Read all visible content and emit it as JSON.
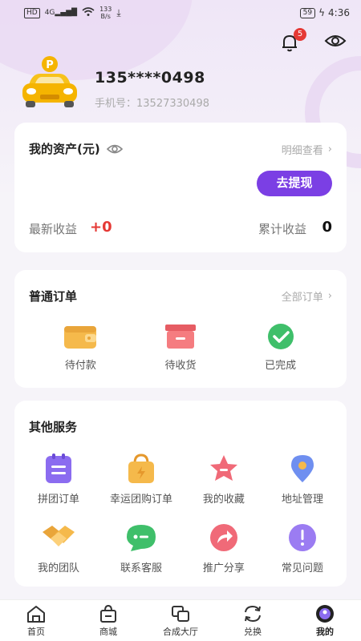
{
  "status_bar": {
    "hd": "HD",
    "signal": "4G",
    "speed_value": "133",
    "speed_unit": "B/s",
    "battery": "59",
    "time": "4:36"
  },
  "notifications": {
    "count": "5"
  },
  "profile": {
    "phone_masked": "135****0498",
    "phone_label": "手机号：13527330498"
  },
  "assets": {
    "title": "我的资产(元)",
    "detail_link": "明细查看",
    "withdraw_label": "去提现",
    "latest_income_label": "最新收益",
    "latest_income_value": "+0",
    "total_income_label": "累计收益",
    "total_income_value": "0"
  },
  "orders": {
    "title": "普通订单",
    "all_link": "全部订单",
    "items": [
      {
        "label": "待付款",
        "icon": "wallet-icon"
      },
      {
        "label": "待收货",
        "icon": "box-icon"
      },
      {
        "label": "已完成",
        "icon": "check-icon"
      }
    ]
  },
  "services": {
    "title": "其他服务",
    "items": [
      {
        "label": "拼团订单",
        "icon": "clipboard-icon"
      },
      {
        "label": "幸运团购订单",
        "icon": "lucky-bag-icon"
      },
      {
        "label": "我的收藏",
        "icon": "star-icon"
      },
      {
        "label": "地址管理",
        "icon": "location-pin-icon"
      },
      {
        "label": "我的团队",
        "icon": "handshake-icon"
      },
      {
        "label": "联系客服",
        "icon": "chat-icon"
      },
      {
        "label": "推广分享",
        "icon": "share-icon"
      },
      {
        "label": "常见问题",
        "icon": "question-icon"
      }
    ]
  },
  "tabbar": {
    "items": [
      {
        "label": "首页",
        "icon": "home-icon"
      },
      {
        "label": "商城",
        "icon": "shop-icon"
      },
      {
        "label": "合成大厅",
        "icon": "merge-icon"
      },
      {
        "label": "兑换",
        "icon": "exchange-icon"
      },
      {
        "label": "我的",
        "icon": "profile-icon",
        "active": true
      }
    ]
  },
  "colors": {
    "accent": "#7b3fe4",
    "income_red": "#e53935"
  }
}
